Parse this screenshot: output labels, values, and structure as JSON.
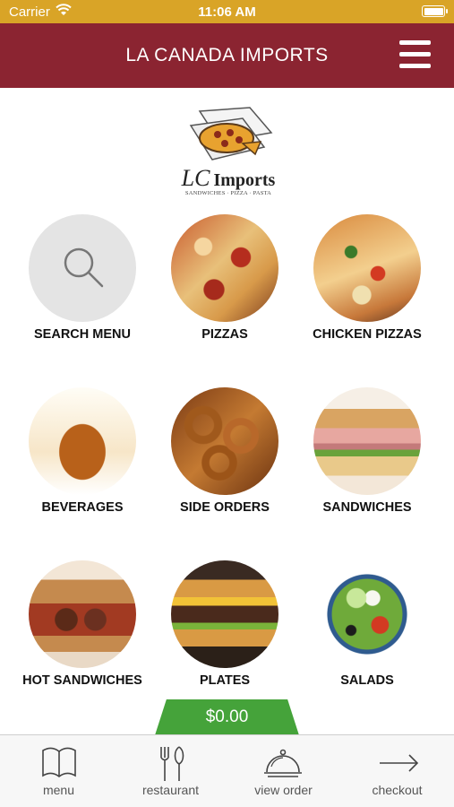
{
  "status_bar": {
    "carrier": "Carrier",
    "time": "11:06 AM"
  },
  "header": {
    "title": "LA CANADA IMPORTS",
    "menu_icon": "hamburger-icon"
  },
  "logo": {
    "monogram": "LC",
    "name": "Imports",
    "tagline": "SANDWICHES · PIZZA · PASTA"
  },
  "categories": [
    {
      "label": "SEARCH MENU",
      "icon": "search-icon"
    },
    {
      "label": "PIZZAS"
    },
    {
      "label": "CHICKEN PIZZAS"
    },
    {
      "label": "BEVERAGES"
    },
    {
      "label": "SIDE ORDERS"
    },
    {
      "label": "SANDWICHES"
    },
    {
      "label": "HOT SANDWICHES"
    },
    {
      "label": "PLATES"
    },
    {
      "label": "SALADS"
    }
  ],
  "cart": {
    "total": "$0.00"
  },
  "tab_bar": {
    "items": [
      {
        "label": "menu",
        "icon": "book-icon"
      },
      {
        "label": "restaurant",
        "icon": "fork-knife-icon"
      },
      {
        "label": "view order",
        "icon": "cloche-icon"
      },
      {
        "label": "checkout",
        "icon": "arrow-right-icon"
      }
    ]
  },
  "colors": {
    "status_bar": "#d9a427",
    "header": "#8b2431",
    "cart_tab": "#45a33a"
  }
}
